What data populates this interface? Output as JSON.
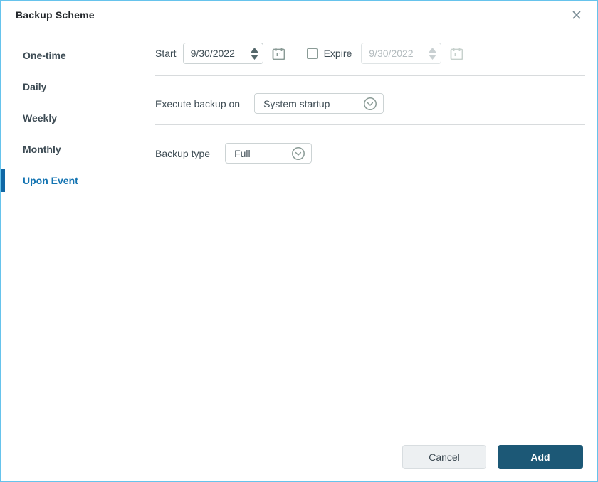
{
  "window": {
    "title": "Backup Scheme"
  },
  "sidebar": {
    "items": [
      {
        "label": "One-time",
        "selected": false
      },
      {
        "label": "Daily",
        "selected": false
      },
      {
        "label": "Weekly",
        "selected": false
      },
      {
        "label": "Monthly",
        "selected": false
      },
      {
        "label": "Upon Event",
        "selected": true
      }
    ]
  },
  "main": {
    "start": {
      "label": "Start",
      "value": "9/30/2022"
    },
    "expire": {
      "label": "Expire",
      "checked": false,
      "value": "9/30/2022"
    },
    "execute": {
      "label": "Execute backup on",
      "value": "System startup"
    },
    "backup_type": {
      "label": "Backup type",
      "value": "Full"
    }
  },
  "footer": {
    "cancel_label": "Cancel",
    "add_label": "Add"
  },
  "icons": {
    "close": "close-icon",
    "calendar": "calendar-icon",
    "chevron_down_circle": "chevron-down-circle-icon",
    "spinner_up": "spinner-up-icon",
    "spinner_down": "spinner-down-icon"
  },
  "colors": {
    "window_border": "#66c3ec",
    "accent_blue": "#1474b2",
    "indicator_blue": "#1068a6",
    "add_button": "#1c5876",
    "icon_gray_green": "#8a9b96",
    "separator": "#d8dbdd",
    "disabled_text": "#b4bcbf"
  }
}
